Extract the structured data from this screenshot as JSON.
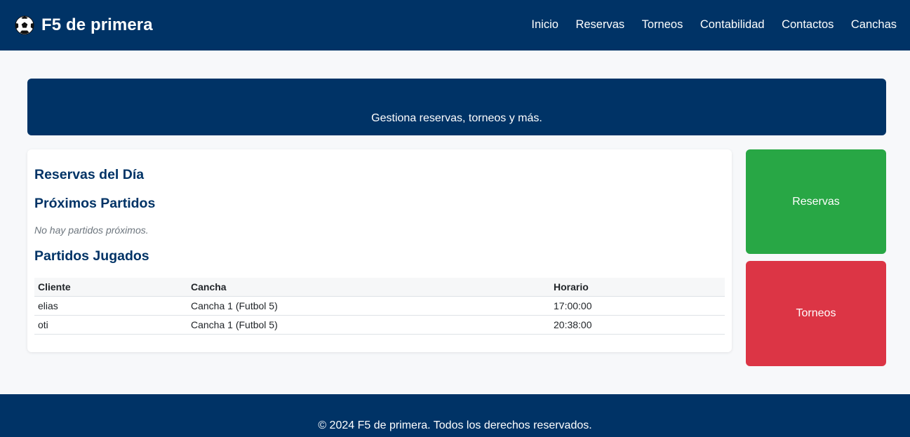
{
  "brand": {
    "name": "F5 de primera",
    "icon": "soccer-ball-icon"
  },
  "nav": {
    "items": [
      "Inicio",
      "Reservas",
      "Torneos",
      "Contabilidad",
      "Contactos",
      "Canchas"
    ]
  },
  "hero": {
    "subtitle": "Gestiona reservas, torneos y más."
  },
  "main": {
    "reservas_title": "Reservas del Día",
    "proximos_title": "Próximos Partidos",
    "proximos_empty": "No hay partidos próximos.",
    "jugados_title": "Partidos Jugados",
    "table": {
      "headers": [
        "Cliente",
        "Cancha",
        "Horario"
      ],
      "rows": [
        [
          "elias",
          "Cancha 1 (Futbol 5)",
          "17:00:00"
        ],
        [
          "oti",
          "Cancha 1 (Futbol 5)",
          "20:38:00"
        ]
      ]
    }
  },
  "sidebar": {
    "reservas": {
      "label": "Reservas",
      "color": "#28a745"
    },
    "torneos": {
      "label": "Torneos",
      "color": "#dc3545"
    }
  },
  "footer": {
    "text": "© 2024 F5 de primera. Todos los derechos reservados."
  },
  "colors": {
    "primary": "#003366",
    "background": "#f7f8fa"
  }
}
